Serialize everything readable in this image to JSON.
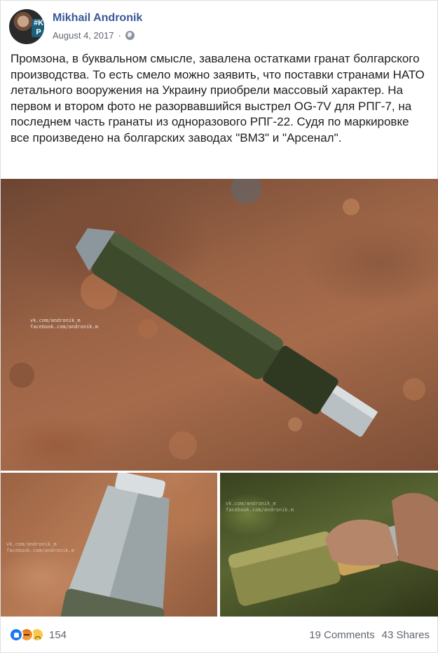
{
  "post": {
    "author": "Mikhail Andronik",
    "date": "August 4, 2017",
    "separator": "·",
    "avatar_badge": "#K P",
    "privacy_icon": "globe-icon",
    "text": "Промзона, в буквальном смысле, завалена остатками гранат болгарского производства. То есть смело можно заявить, что поставки странами НАТО летального вооружения на Украину приобрели массовый характер. На первом и втором фото не разорвавшийся выстрел OG-7V для РПГ-7, на последнем часть гранаты из одноразового РПГ-22. Судя по маркировке все произведено на болгарских заводах \"ВМЗ\" и \"Арсенал\"."
  },
  "photos": {
    "main_watermark": "vk.com/andronik_m\nfacebook.com/andronik.m",
    "left_watermark": "vk.com/andronik_m\nfacebook.com/andronik.m",
    "right_watermark": "vk.com/andronik_m\nfacebook.com/andronik.m"
  },
  "footer": {
    "reaction_icons": [
      "like-icon",
      "angry-icon",
      "sad-icon"
    ],
    "reaction_count": "154",
    "comments": "19 Comments",
    "shares": "43 Shares"
  },
  "colors": {
    "author_link": "#385898",
    "meta": "#616770",
    "like": "#1877f2"
  }
}
